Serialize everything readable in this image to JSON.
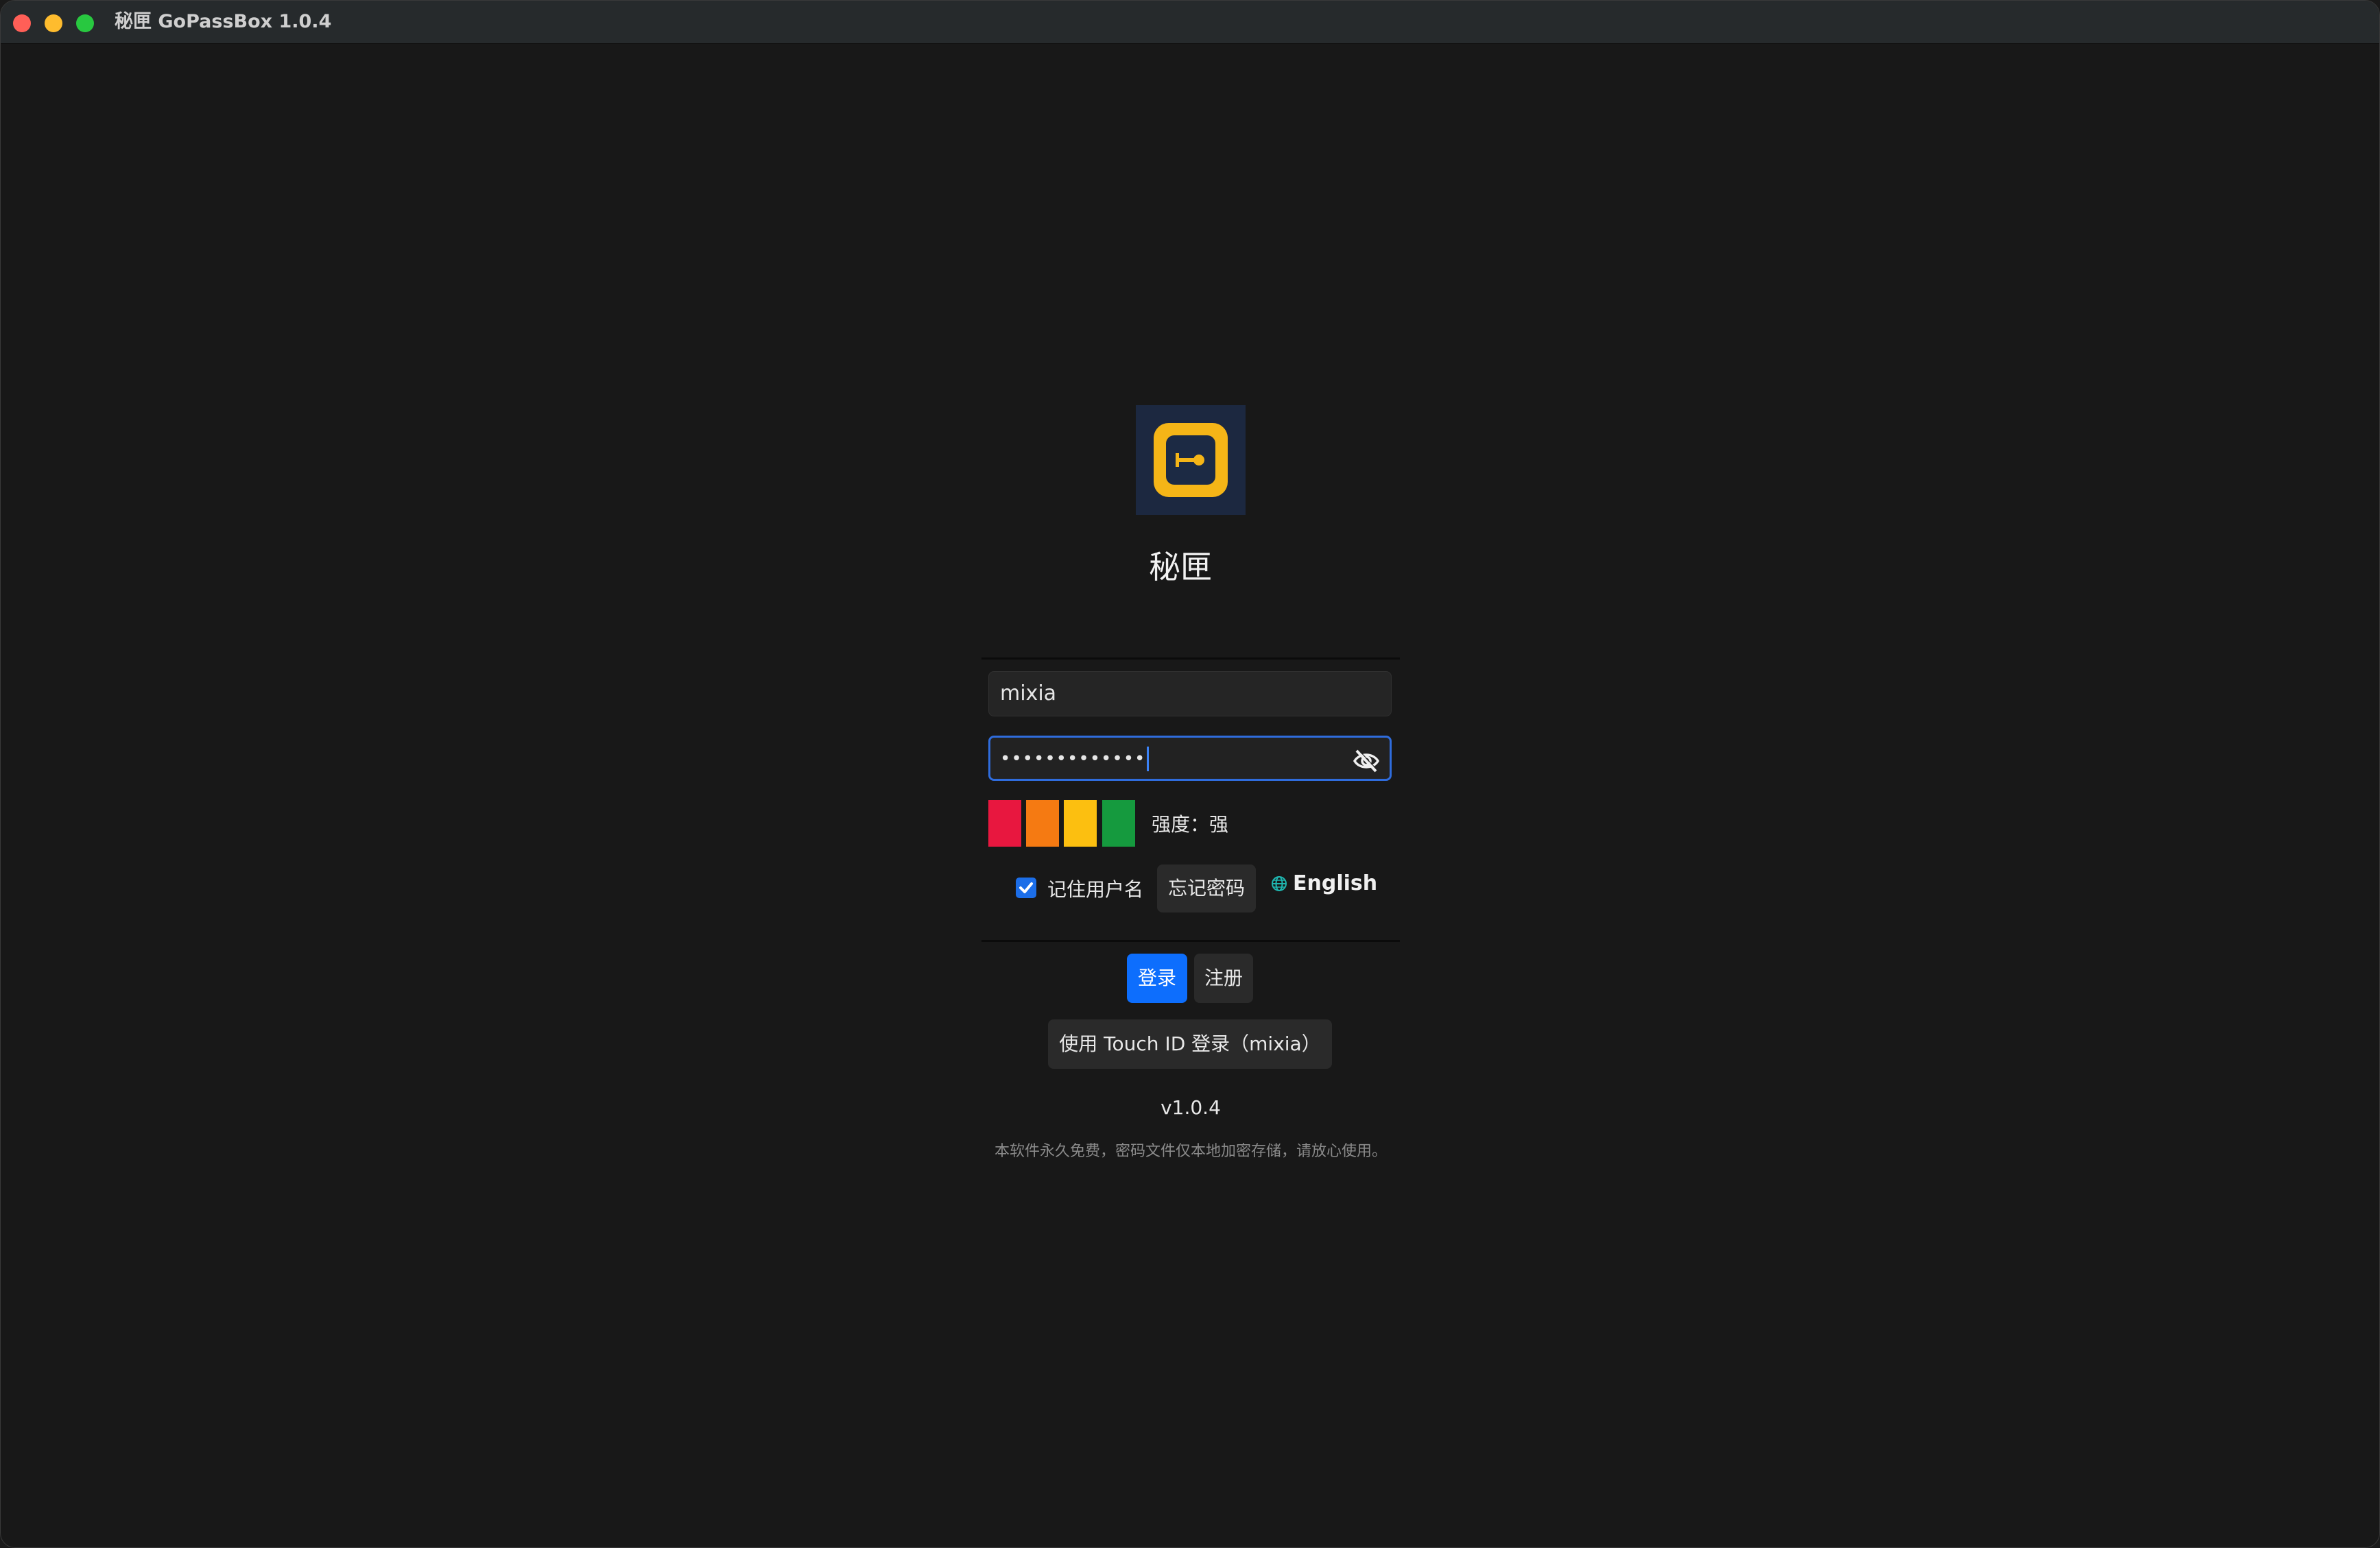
{
  "window": {
    "title": "秘匣 GoPassBox 1.0.4"
  },
  "brand": {
    "app_name": "秘匣",
    "logo_icon": "key-box-icon",
    "logo_color": "#f5b517",
    "logo_bg": "#1c2840"
  },
  "form": {
    "username_value": "mixia",
    "password_masked": "•••••••••••••",
    "password_visibility_icon": "eye-off-icon"
  },
  "strength": {
    "colors": [
      "#e8173f",
      "#f57a12",
      "#fcbf10",
      "#159a3e"
    ],
    "label": "强度：强",
    "level": 4,
    "max_level": 4
  },
  "options": {
    "remember_label": "记住用户名",
    "remember_checked": true,
    "forgot_label": "忘记密码",
    "language_label": "English",
    "language_icon": "globe-icon"
  },
  "actions": {
    "login_label": "登录",
    "register_label": "注册",
    "touchid_label": "使用 Touch ID 登录（mixia）"
  },
  "footer": {
    "version": "v1.0.4",
    "note": "本软件永久免费，密码文件仅本地加密存储，请放心使用。"
  },
  "colors": {
    "accent": "#0d6efd",
    "background": "#181818"
  }
}
